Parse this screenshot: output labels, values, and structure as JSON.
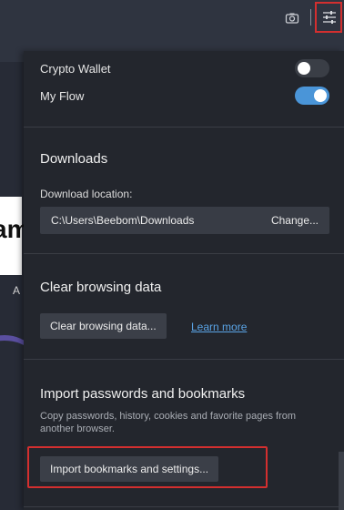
{
  "toolbar": {
    "camera_icon": "camera-icon",
    "easy_setup_icon": "sliders-icon"
  },
  "background_page": {
    "tile_text": "am",
    "caption": "A"
  },
  "settings": {
    "toggles": [
      {
        "label": "Crypto Wallet",
        "state": "off"
      },
      {
        "label": "My Flow",
        "state": "on"
      }
    ],
    "downloads": {
      "title": "Downloads",
      "location_label": "Download location:",
      "path": "C:\\Users\\Beebom\\Downloads",
      "change_label": "Change..."
    },
    "clear_data": {
      "title": "Clear browsing data",
      "button_label": "Clear browsing data...",
      "learn_more": "Learn more"
    },
    "import": {
      "title": "Import passwords and bookmarks",
      "description": "Copy passwords, history, cookies and favorite pages from another browser.",
      "button_label": "Import bookmarks and settings..."
    }
  },
  "colors": {
    "accent": "#4a95d8",
    "highlight": "#d32f2f",
    "panel": "#23262d"
  }
}
